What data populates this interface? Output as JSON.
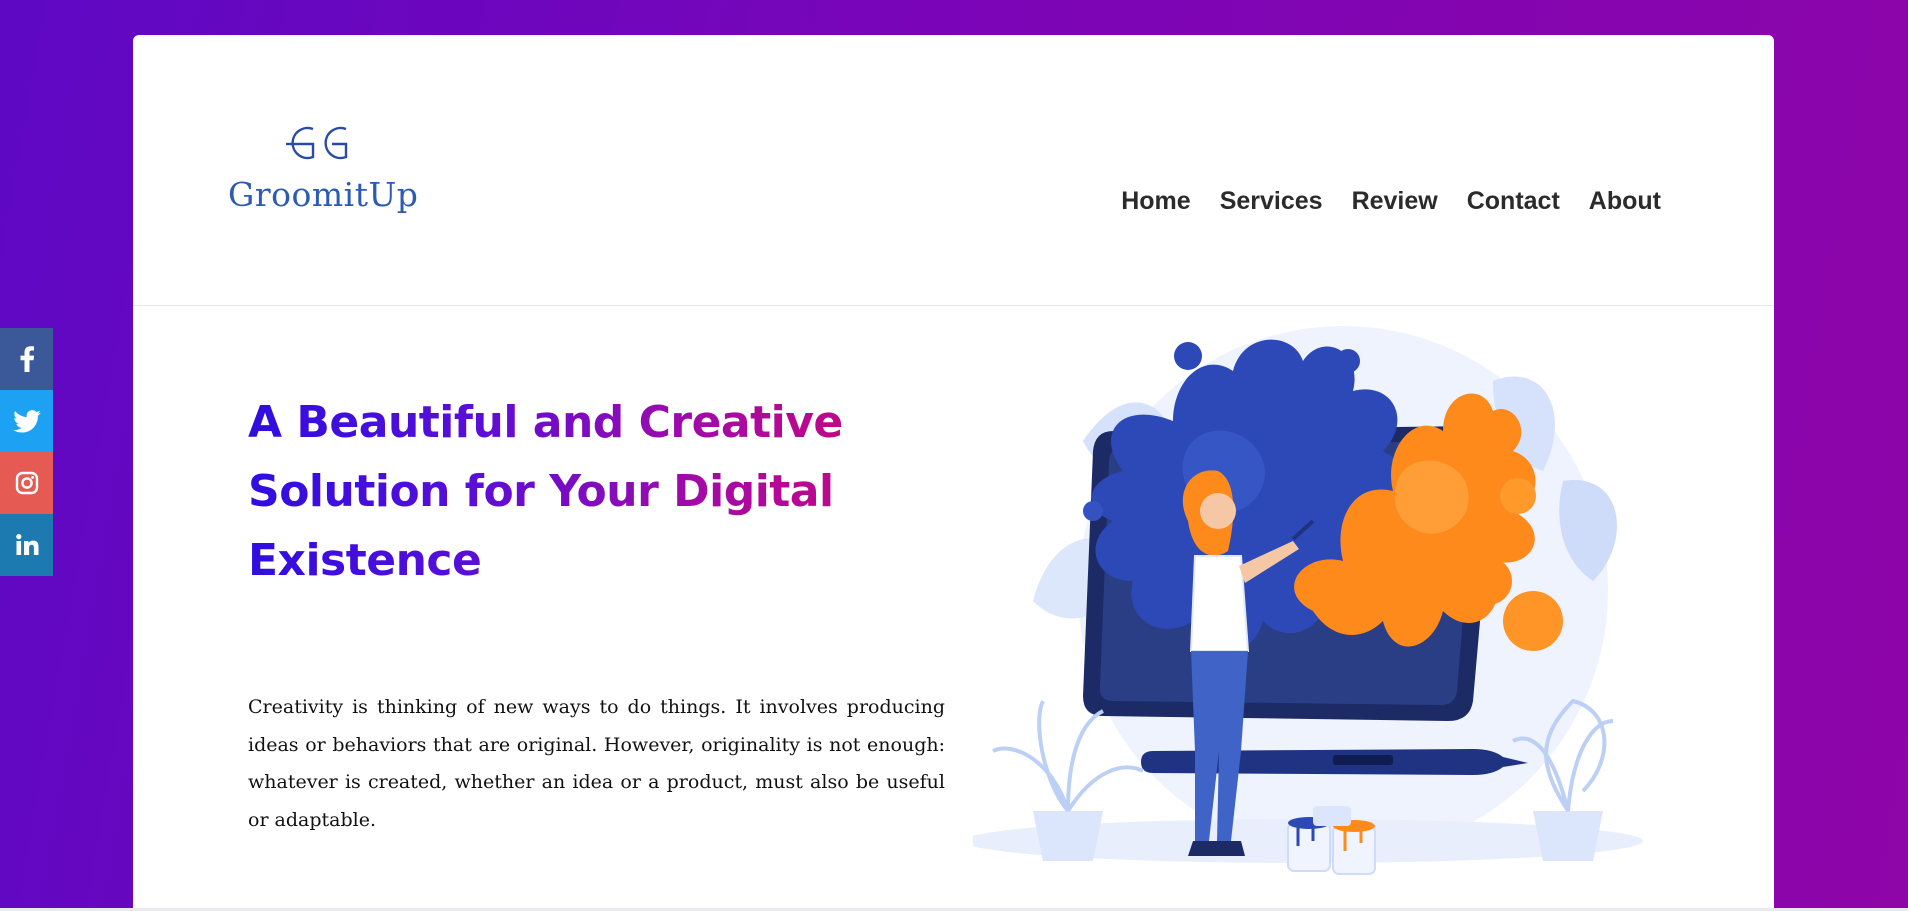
{
  "brand": {
    "name": "GroomitUp",
    "logo_mark": "GG-monogram-logo",
    "color": "#2d5bb3"
  },
  "nav": {
    "items": [
      {
        "label": "Home"
      },
      {
        "label": "Services"
      },
      {
        "label": "Review"
      },
      {
        "label": "Contact"
      },
      {
        "label": "About"
      }
    ]
  },
  "hero": {
    "title": "A Beautiful and Creative Solution for Your Digital Existence",
    "body": "Creativity is thinking of new ways to do things. It involves producing ideas or behaviors that are original. However, originality is not enough: whatever is created, whether an idea or a product, must also be useful or adaptable.",
    "illustration": "artist-painting-on-tablet-illustration"
  },
  "social": {
    "items": [
      {
        "name": "facebook",
        "icon": "facebook-icon",
        "color": "#3b5998"
      },
      {
        "name": "twitter",
        "icon": "twitter-icon",
        "color": "#1da1f2"
      },
      {
        "name": "instagram",
        "icon": "instagram-icon",
        "color": "#e55b54"
      },
      {
        "name": "linkedin",
        "icon": "linkedin-icon",
        "color": "#1c7ab0"
      }
    ]
  },
  "colors": {
    "background_gradient": [
      "#5e08c4",
      "#8e05a8"
    ],
    "title_gradient": [
      "#2e0ee0",
      "#c8077e"
    ],
    "accent_orange": "#ff8a1c",
    "accent_blue": "#2d49b8"
  }
}
